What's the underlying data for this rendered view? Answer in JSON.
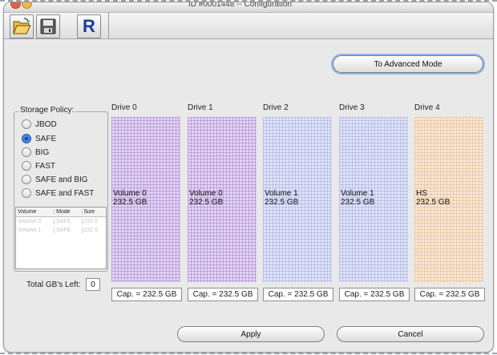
{
  "window": {
    "title": "ID #0001448 -- Configuration"
  },
  "toolbar": {
    "open_icon": "folder-open-icon",
    "save_icon": "floppy-disk-icon",
    "r_label": "R"
  },
  "advanced_button": "To Advanced Mode",
  "storage_policy": {
    "legend": "Storage Policy:",
    "options": [
      "JBOD",
      "SAFE",
      "BIG",
      "FAST",
      "SAFE and BIG",
      "SAFE and FAST"
    ],
    "selected": "SAFE"
  },
  "volume_table": {
    "headers": [
      "Volume",
      "Mode",
      "Size"
    ],
    "rows": [
      [
        "Volume 0",
        "SAFE",
        "232.5"
      ],
      [
        "Volume 1",
        "SAFE",
        "232.5"
      ]
    ]
  },
  "total": {
    "label": "Total GB's Left:",
    "value": "0"
  },
  "drives": [
    {
      "label": "Drive 0",
      "volume": "Volume 0",
      "size": "232.5 GB",
      "capacity": "Cap. = 232.5 GB",
      "color": "#e3d4f2"
    },
    {
      "label": "Drive 1",
      "volume": "Volume 0",
      "size": "232.5 GB",
      "capacity": "Cap. = 232.5 GB",
      "color": "#e3d4f2"
    },
    {
      "label": "Drive 2",
      "volume": "Volume 1",
      "size": "232.5 GB",
      "capacity": "Cap. = 232.5 GB",
      "color": "#dfe3f6"
    },
    {
      "label": "Drive 3",
      "volume": "Volume 1",
      "size": "232.5 GB",
      "capacity": "Cap. = 232.5 GB",
      "color": "#dfe3f6"
    },
    {
      "label": "Drive 4",
      "volume": "HS",
      "size": "232.5 GB",
      "capacity": "Cap. = 232.5 GB",
      "color": "#f6e8d8"
    }
  ],
  "buttons": {
    "apply": "Apply",
    "cancel": "Cancel"
  }
}
